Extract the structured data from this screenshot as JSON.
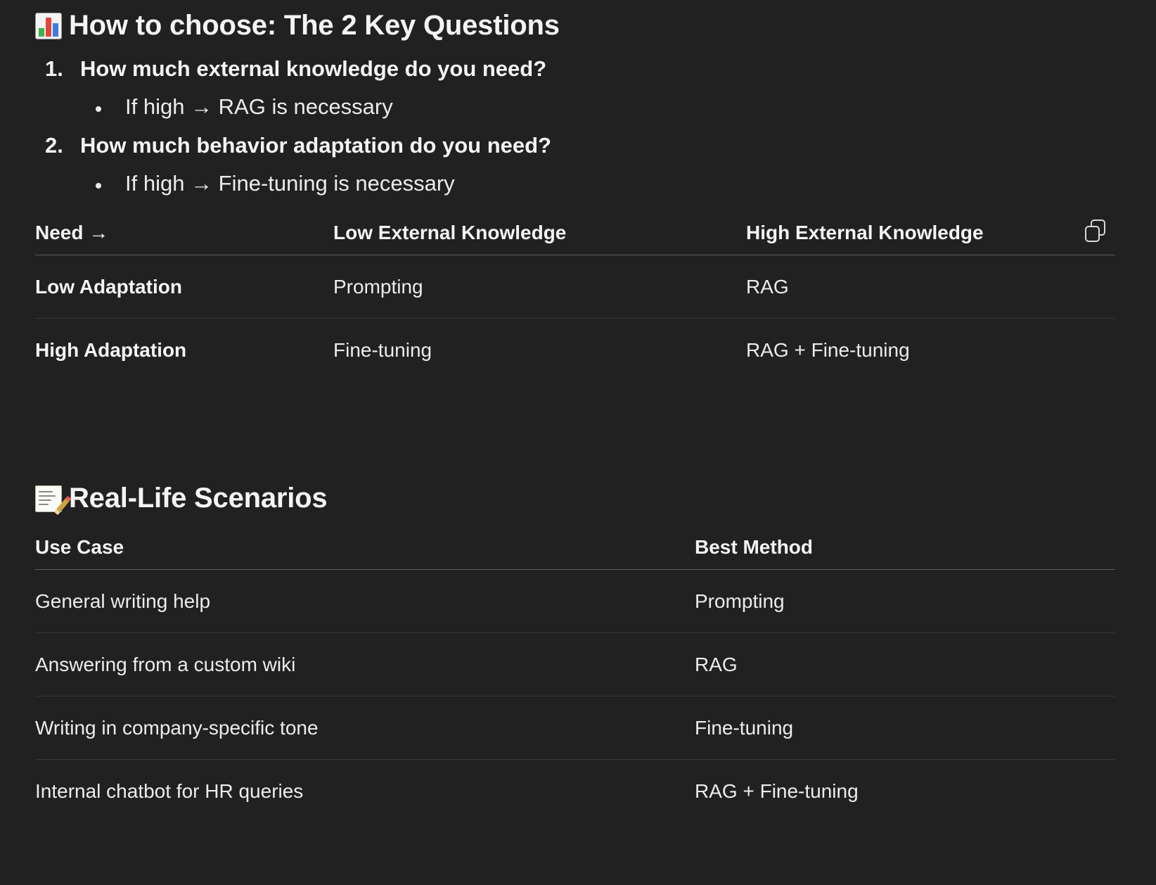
{
  "section1": {
    "title": "How to choose: The 2 Key Questions",
    "icon": "bar-chart-icon",
    "questions": [
      {
        "number": "1.",
        "text": "How much external knowledge do you need?",
        "sub": "If high → RAG is necessary"
      },
      {
        "number": "2.",
        "text": "How much behavior adaptation do you need?",
        "sub": "If high → Fine-tuning is necessary"
      }
    ],
    "table": {
      "headers": [
        "Need →",
        "Low External Knowledge",
        "High External Knowledge"
      ],
      "rows": [
        [
          "Low Adaptation",
          "Prompting",
          "RAG"
        ],
        [
          "High Adaptation",
          "Fine-tuning",
          "RAG + Fine-tuning"
        ]
      ],
      "copy_icon": "copy-icon"
    }
  },
  "section2": {
    "title": "Real-Life Scenarios",
    "icon": "memo-icon",
    "table": {
      "headers": [
        "Use Case",
        "Best Method"
      ],
      "rows": [
        [
          "General writing help",
          "Prompting"
        ],
        [
          "Answering from a custom wiki",
          "RAG"
        ],
        [
          "Writing in company-specific tone",
          "Fine-tuning"
        ],
        [
          "Internal chatbot for HR queries",
          "RAG + Fine-tuning"
        ]
      ]
    }
  },
  "colors": {
    "background": "#212121",
    "text": "#ececec",
    "heading": "#f4f4f4",
    "divider": "#363636"
  }
}
